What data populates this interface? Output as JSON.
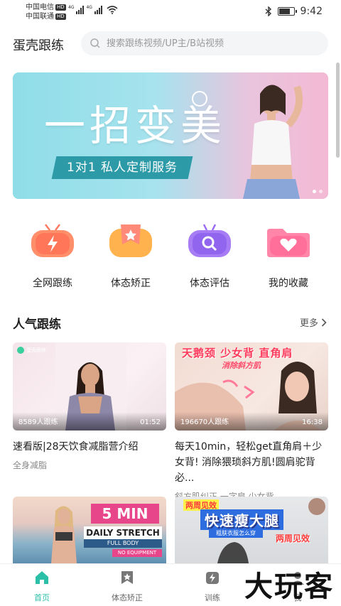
{
  "status_bar": {
    "carrier1": "中国电信",
    "carrier2": "中国联通",
    "hd": "HD",
    "net1": "4G",
    "net2": "4G",
    "time": "9:42"
  },
  "header": {
    "app_title": "蛋壳跟练",
    "search_placeholder": "搜索跟练视频/UP主/B站视频"
  },
  "banner": {
    "headline": "一招变美",
    "subline": "1对1 私人定制服务",
    "dots": 2,
    "active_dot": 0
  },
  "quick_actions": [
    {
      "label": "全网跟练",
      "icon": "lightning-tv-icon",
      "color": "#ff7a63"
    },
    {
      "label": "体态矫正",
      "icon": "star-tv-icon",
      "color": "#ffa649"
    },
    {
      "label": "体态评估",
      "icon": "magnifier-tv-icon",
      "color": "#9b6cf3"
    },
    {
      "label": "我的收藏",
      "icon": "heart-folder-icon",
      "color": "#ff6f9a"
    }
  ],
  "section": {
    "title": "人气跟练",
    "more": "更多"
  },
  "cards": [
    {
      "participants": "8589人跟练",
      "duration": "01:52",
      "title": "速看版|28天饮食减脂营介绍",
      "tags": "全身减脂",
      "thumb_badge": "蛋壳跟练"
    },
    {
      "participants": "196670人跟练",
      "duration": "16:38",
      "title": "每天10min，轻松get直角肩＋少女背! 消除猥琐斜方肌!圆肩驼背必...",
      "tags": "斜方肌纠正 一字肩 少女背",
      "thumb_line1": "天鹅颈 少女背 直角肩",
      "thumb_line2": "消除斜方肌"
    },
    {
      "thumb_big": "5 MIN",
      "thumb_line1": "DAILY STRETCH",
      "thumb_line2": "FULL BODY",
      "thumb_line3": "NO EQUIPMENT"
    },
    {
      "thumb_line1": "两周见效",
      "thumb_big": "快速瘦大腿",
      "thumb_line2": "粗肤衣服怎么穿",
      "thumb_line3": "两周见效"
    }
  ],
  "tabbar": [
    {
      "label": "首页",
      "icon": "home-icon",
      "active": true
    },
    {
      "label": "体态矫正",
      "icon": "bookmark-star-icon",
      "active": false
    },
    {
      "label": "训练",
      "icon": "lightning-icon",
      "active": false
    },
    {
      "label": "我",
      "icon": "profile-icon",
      "active": false
    }
  ],
  "watermark": "大玩客",
  "colors": {
    "accent": "#2cbfa8",
    "banner_teal": "#2d9aa8"
  }
}
